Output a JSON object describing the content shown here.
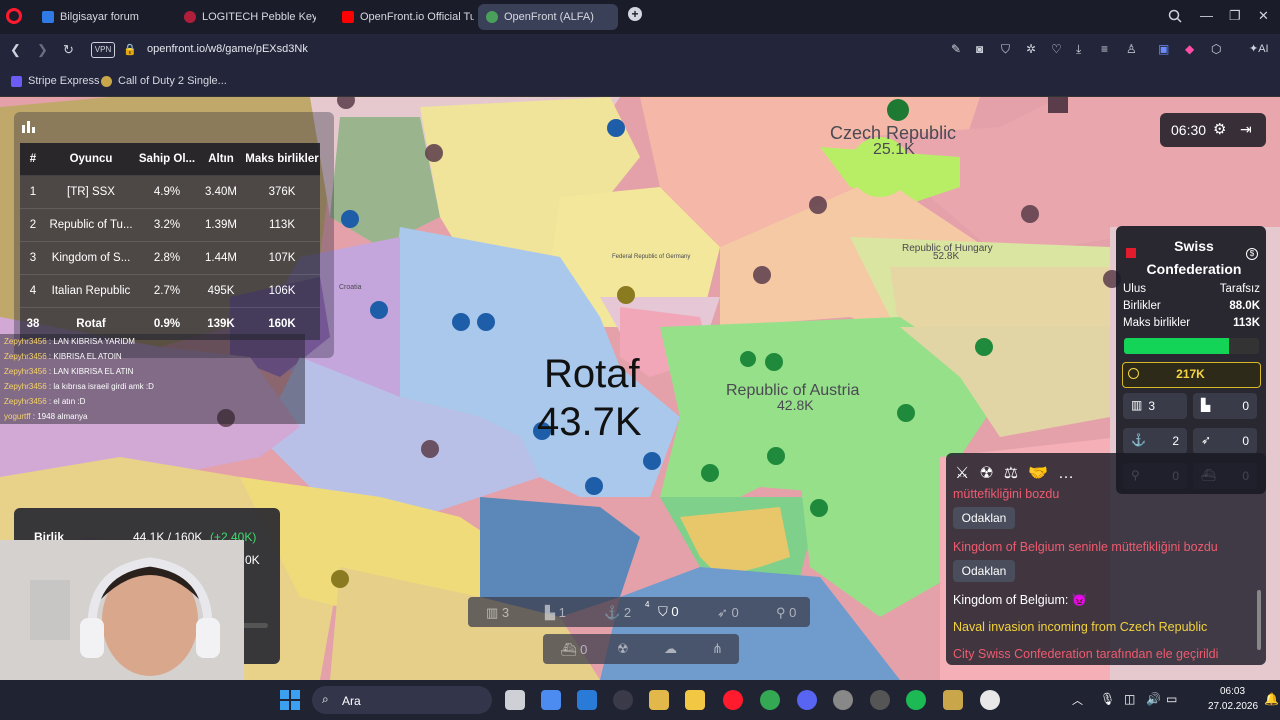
{
  "tabs": [
    {
      "label": "Bilgisayar forum",
      "color": "#2f7ae5",
      "active": false
    },
    {
      "label": "LOGITECH Pebble Keys 2 K",
      "color": "#b01f3a",
      "active": false
    },
    {
      "label": "OpenFront.io Official Tuto",
      "color": "#ff0000",
      "active": false
    },
    {
      "label": "OpenFront (ALFA)",
      "color": "#4aa05a",
      "active": true
    }
  ],
  "browser": {
    "url": "openfront.io/w8/game/pEXsd3Nk",
    "vpn_label": "VPN",
    "ai_label": "AI",
    "bookmarks": [
      {
        "label": "Stripe Express",
        "color": "#6b5cf5"
      },
      {
        "label": "Call of Duty 2 Single...",
        "color": "#c9a64a"
      }
    ]
  },
  "leaderboard": {
    "headers": [
      "#",
      "Oyuncu",
      "Sahip Ol...",
      "Altın",
      "Maks birlikler"
    ],
    "rows": [
      {
        "rank": "1",
        "player": "[TR] SSX",
        "owned": "4.9%",
        "gold": "3.40M",
        "max": "376K"
      },
      {
        "rank": "2",
        "player": "Republic of Tu...",
        "owned": "3.2%",
        "gold": "1.39M",
        "max": "113K"
      },
      {
        "rank": "3",
        "player": "Kingdom of S...",
        "owned": "2.8%",
        "gold": "1.44M",
        "max": "107K"
      },
      {
        "rank": "4",
        "player": "Italian Republic",
        "owned": "2.7%",
        "gold": "495K",
        "max": "106K"
      },
      {
        "rank": "38",
        "player": "Rotaf",
        "owned": "0.9%",
        "gold": "139K",
        "max": "160K"
      }
    ]
  },
  "chat": [
    {
      "user": "Zepyhr3456",
      "msg": "LAN KIBRISA YARIDM"
    },
    {
      "user": "Zepyhr3456",
      "msg": "KIBRISA EL ATOIN"
    },
    {
      "user": "Zepyhr3456",
      "msg": "LAN KIBRISA EL ATIN"
    },
    {
      "user": "Zepyhr3456",
      "msg": "la kıbrısa israeil girdi amk :D"
    },
    {
      "user": "Zepyhr3456",
      "msg": "el atın :D"
    },
    {
      "user": "yogurtff",
      "msg": "1948 almanya"
    }
  ],
  "map": {
    "player_name": "Rotaf",
    "player_troops": "43.7K",
    "labels": {
      "czech": "Czech Republic",
      "czech_val": "25.1K",
      "austria": "Republic of Austria",
      "austria_val": "42.8K",
      "hungary": "Republic of Hungary",
      "hungary_val": "52.8K",
      "germany": "Federal Republic of Germany",
      "croatia": "Croatia"
    }
  },
  "timer": "06:30",
  "nation_panel": {
    "name": "Swiss Confederation",
    "rows": [
      {
        "label": "Ulus",
        "value": "Tarafsız"
      },
      {
        "label": "Birlikler",
        "value": "88.0K"
      },
      {
        "label": "Maks birlikler",
        "value": "113K"
      }
    ],
    "troop_fill": 0.78,
    "gold": "217K",
    "stats": [
      "3",
      "0",
      "2",
      "0",
      "0",
      "0"
    ]
  },
  "events": {
    "lines": [
      {
        "text": "müttefikliğini bozdu",
        "color": "#ef5a6f"
      },
      {
        "text": "Kingdom of Belgium seninle müttefikliğini bozdu",
        "color": "#ef5a6f"
      },
      {
        "text": "Kingdom of Belgium: 👿",
        "color": "#ffffff"
      },
      {
        "text": "Naval invasion incoming from Czech Republic",
        "color": "#f3d33a"
      },
      {
        "text": "City Swiss Confederation tarafından ele geçirildi",
        "color": "#ef5a6f"
      }
    ],
    "focus_label": "Odaklan"
  },
  "attack": {
    "label": "Birlik",
    "value": "44.1K / 160K",
    "delta": "(+2.40K)",
    "gold": "0K"
  },
  "buildbar": {
    "row1": [
      "3",
      "1",
      "2",
      "0",
      "0",
      "0"
    ],
    "row2": [
      "0"
    ],
    "shortcuts": [
      "4"
    ]
  },
  "taskbar": {
    "search_placeholder": "Ara",
    "time": "06:03",
    "date": "27.02.2026"
  }
}
